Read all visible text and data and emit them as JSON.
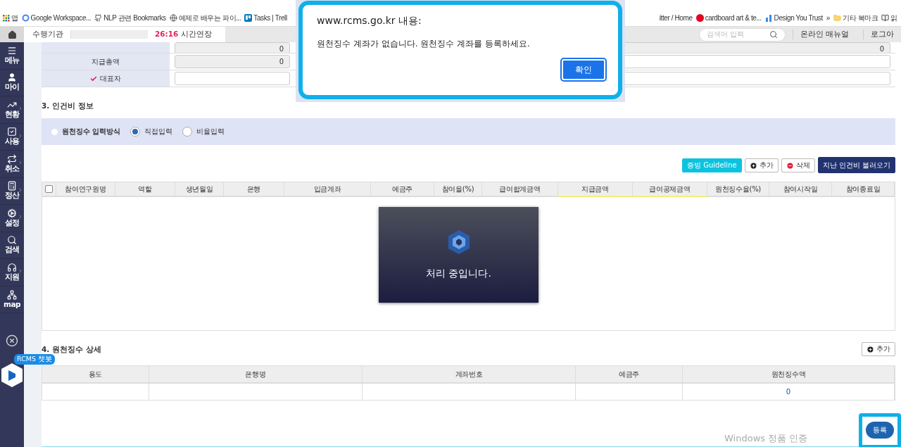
{
  "bookmarks_left": [
    {
      "label": "앱",
      "kind": "apps"
    },
    {
      "label": "Google Workspace...",
      "kind": "google"
    },
    {
      "label": "NLP 관련 Bookmarks",
      "kind": "github"
    },
    {
      "label": "예제로 배우는 파이...",
      "kind": "globe"
    },
    {
      "label": "Tasks | Trell",
      "kind": "trello"
    }
  ],
  "bookmarks_right": [
    {
      "label": "itter / Home",
      "kind": "none"
    },
    {
      "label": "cardboard art & te...",
      "kind": "pinterest"
    },
    {
      "label": "Design You Trust",
      "kind": "bars"
    },
    {
      "label": "»",
      "kind": "none"
    },
    {
      "label": "기타 북마크",
      "kind": "folder"
    },
    {
      "label": "읽",
      "kind": "list"
    }
  ],
  "top_nav": {
    "org_label": "수행기관",
    "timer": "26:16",
    "extend": "시간연장",
    "search_placeholder": "검색어 입력",
    "links": [
      "온라인 매뉴얼",
      "로그아"
    ]
  },
  "sidebar": {
    "items": [
      {
        "label": "메뉴",
        "kind": "menu",
        "chevron": false
      },
      {
        "label": "마이",
        "kind": "user",
        "chevron": false
      },
      {
        "label": "현황",
        "kind": "chart",
        "chevron": true
      },
      {
        "label": "사용",
        "kind": "check",
        "chevron": true
      },
      {
        "label": "취소",
        "kind": "repeat",
        "chevron": true
      },
      {
        "label": "정산",
        "kind": "calc",
        "chevron": true
      },
      {
        "label": "설정",
        "kind": "cogs",
        "chevron": true
      },
      {
        "label": "검색",
        "kind": "search",
        "chevron": false
      },
      {
        "label": "지원",
        "kind": "headset",
        "chevron": true
      },
      {
        "label": "map",
        "kind": "sitemap",
        "chevron": false
      }
    ],
    "chatbot_badge": "RCMS 챗봇"
  },
  "form_rows": [
    {
      "label": "",
      "required": false,
      "value": "0",
      "right_value": "0"
    },
    {
      "label": "지급총액",
      "required": false,
      "value": "0",
      "right_value": ""
    },
    {
      "label": "대표자",
      "required": true,
      "value": "",
      "right_value": ""
    }
  ],
  "section3": {
    "title": "3. 인건비 정보",
    "method_label": "원천징수 입력방식",
    "radios": [
      {
        "label": "직접입력",
        "selected": true
      },
      {
        "label": "비율입력",
        "selected": false
      }
    ],
    "buttons": [
      {
        "label": "증빙 Guideline",
        "kind": "guide"
      },
      {
        "label": "추가",
        "kind": "add"
      },
      {
        "label": "삭제",
        "kind": "delete"
      },
      {
        "label": "지난 인건비 불러오기",
        "kind": "load"
      }
    ],
    "columns": [
      {
        "label": "참여연구원명",
        "highlighted": false
      },
      {
        "label": "역할",
        "highlighted": false
      },
      {
        "label": "생년월일",
        "highlighted": false
      },
      {
        "label": "은행",
        "highlighted": false
      },
      {
        "label": "입금계좌",
        "highlighted": false
      },
      {
        "label": "예금주",
        "highlighted": false
      },
      {
        "label": "참여율(%)",
        "highlighted": false
      },
      {
        "label": "급여합계금액",
        "highlighted": false
      },
      {
        "label": "지급금액",
        "highlighted": true
      },
      {
        "label": "급여공제금액",
        "highlighted": true
      },
      {
        "label": "원천징수율(%)",
        "highlighted": false
      },
      {
        "label": "참여시작일",
        "highlighted": false
      },
      {
        "label": "참여종료일",
        "highlighted": false
      }
    ],
    "select_all_checked": false,
    "loading": {
      "text": "처리 중입니다."
    }
  },
  "section4": {
    "title": "4. 원천징수 상세",
    "add_button": "추가",
    "columns": [
      "용도",
      "은행명",
      "계좌번호",
      "예금주",
      "원천징수액"
    ],
    "rows": [
      [
        "",
        "",
        "",
        "",
        "0"
      ]
    ]
  },
  "submit_button": "등록",
  "os_notice": "Windows 정품 인증",
  "dialog": {
    "title": "www.rcms.go.kr 내용:",
    "message": "원천징수 계좌가 없습니다. 원천징수 계좌를 등록하세요.",
    "ok": "확인"
  }
}
